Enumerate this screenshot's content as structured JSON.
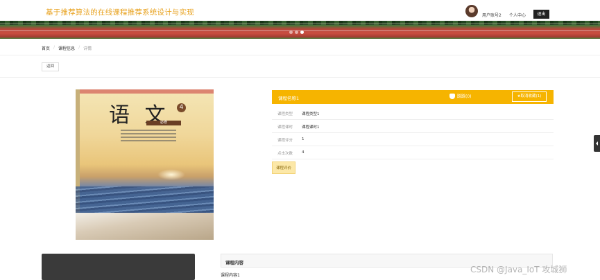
{
  "header": {
    "site_title": "基于推荐算法的在线课程推荐系统设计与实现",
    "user_account": "用户账号2",
    "personal_center": "个人中心",
    "logout": "退出"
  },
  "breadcrumb": {
    "home": "首页",
    "section": "课程信息",
    "current": "详情",
    "sep": "/"
  },
  "back_button": "返回",
  "cover": {
    "title_big": "语 文",
    "volume_number": "4",
    "volume_label": "必修"
  },
  "course": {
    "name": "课程名称1",
    "dislike_label": "踩踩(0)",
    "favorite_label": "★取消收藏(1)",
    "fields": [
      {
        "label": "课程类型",
        "value": "课程类型1"
      },
      {
        "label": "课程课时",
        "value": "课程课时1"
      },
      {
        "label": "课程评分",
        "value": "1"
      },
      {
        "label": "点击次数",
        "value": "4"
      }
    ],
    "rate_button": "课程评价"
  },
  "content": {
    "heading": "课程内容",
    "body": "课程内容1"
  },
  "watermark": "CSDN @Java_IoT 攻城狮",
  "colors": {
    "accent": "#f6b400",
    "title": "#e8a21f"
  }
}
